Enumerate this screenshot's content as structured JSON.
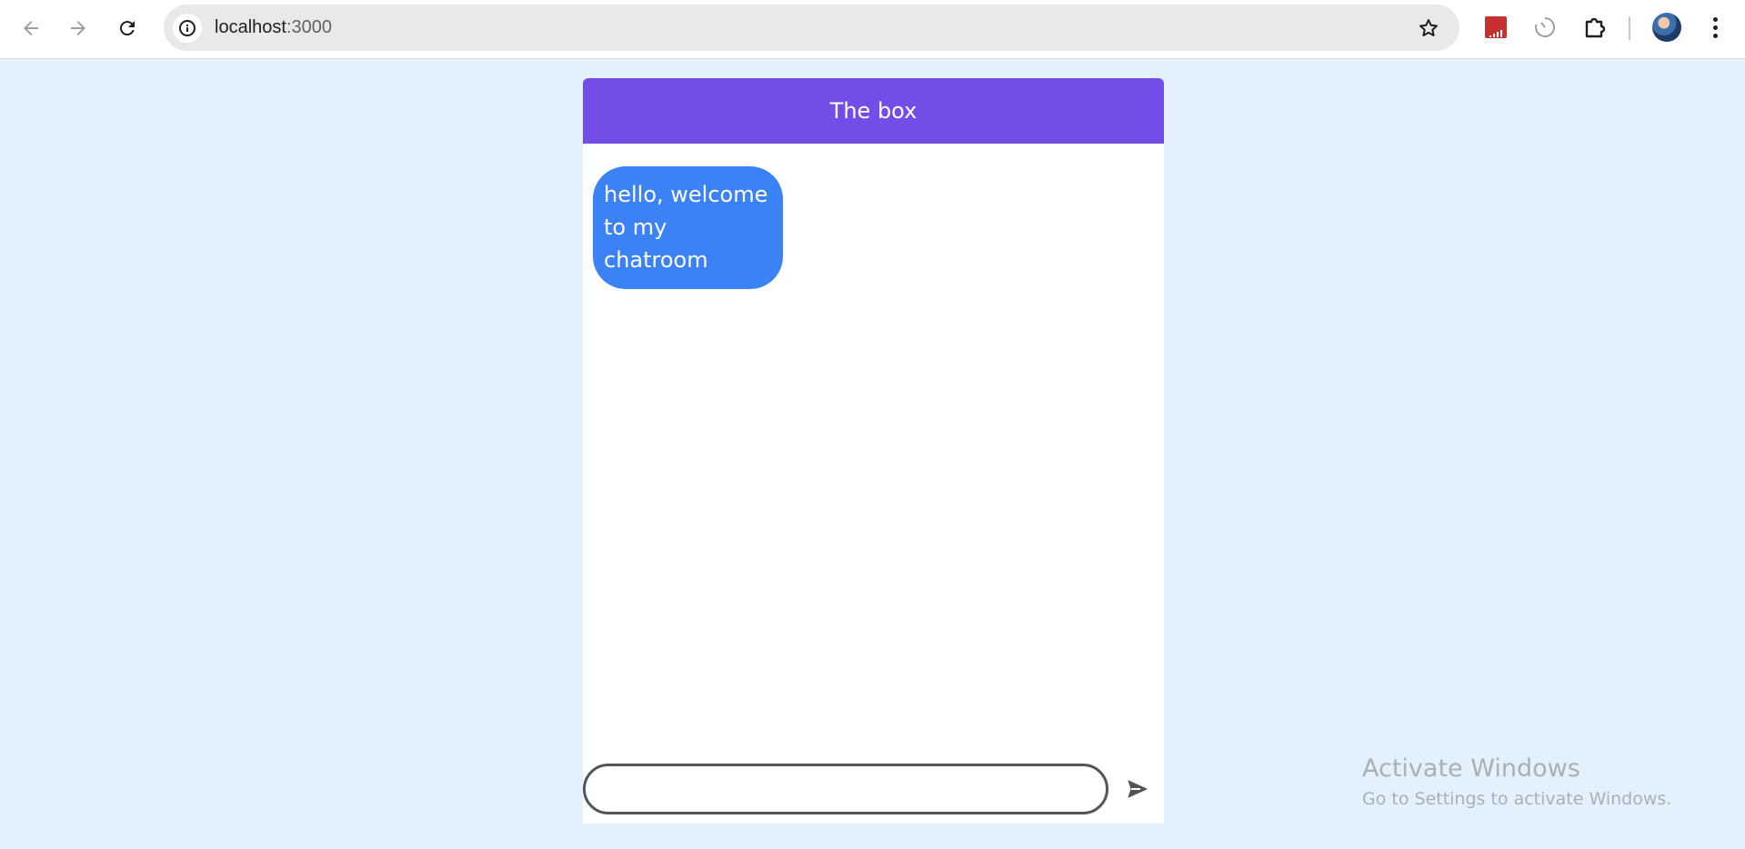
{
  "browser": {
    "url_host": "localhost",
    "url_port": ":3000",
    "icons": {
      "back": "back-arrow-icon",
      "forward": "forward-arrow-icon",
      "reload": "reload-icon",
      "site_info": "info-icon",
      "bookmark": "star-icon",
      "extension_1": "bar-chart-icon",
      "extension_2": "timer-icon",
      "extensions": "puzzle-icon",
      "profile": "avatar",
      "menu": "kebab-menu-icon"
    }
  },
  "chat": {
    "title": "The box",
    "header_color": "#744ce8",
    "messages": [
      {
        "text": "hello, welcome to my chatroom",
        "bubble_color": "#3b82f6"
      }
    ],
    "input": {
      "value": "",
      "placeholder": ""
    },
    "send_icon": "send-icon"
  },
  "watermark": {
    "title": "Activate Windows",
    "subtitle": "Go to Settings to activate Windows."
  },
  "colors": {
    "page_background": "#e3f1fc",
    "accent": "#744ce8",
    "bubble": "#3b82f6"
  }
}
